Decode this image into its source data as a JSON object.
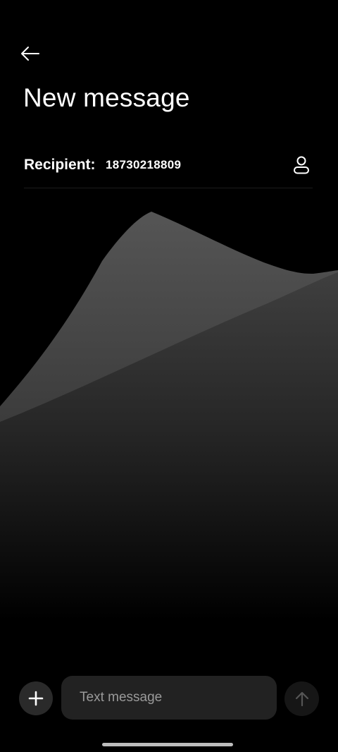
{
  "header": {
    "back_icon": "arrow-left-icon",
    "title": "New message"
  },
  "recipient": {
    "label": "Recipient:",
    "value": "18730218809",
    "contact_icon": "person-icon"
  },
  "composer": {
    "add_icon": "plus-icon",
    "placeholder": "Text message",
    "send_icon": "arrow-up-icon"
  },
  "colors": {
    "background": "#000000",
    "input_background": "#222222",
    "add_button": "#2a2a2a",
    "send_button": "#161616",
    "send_icon_disabled": "#555555",
    "placeholder_text": "#9a9a9a"
  }
}
